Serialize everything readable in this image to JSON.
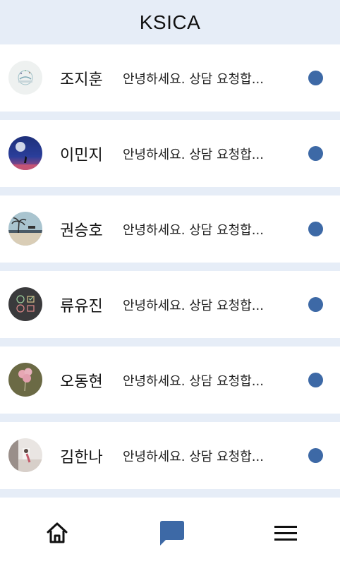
{
  "app": {
    "title": "KSICA"
  },
  "conversations": [
    {
      "name": "조지훈",
      "preview": "안녕하세요. 상담 요청합...",
      "unread": true,
      "avatar": "leaf-art"
    },
    {
      "name": "이민지",
      "preview": "안녕하세요. 상담 요청합...",
      "unread": true,
      "avatar": "night-moon"
    },
    {
      "name": "권승호",
      "preview": "안녕하세요. 상담 요청합...",
      "unread": true,
      "avatar": "beach-palm"
    },
    {
      "name": "류유진",
      "preview": "안녕하세요. 상담 요청합...",
      "unread": true,
      "avatar": "emoji-chalkboard"
    },
    {
      "name": "오동현",
      "preview": "안녕하세요. 상담 요청합...",
      "unread": true,
      "avatar": "pink-balloons"
    },
    {
      "name": "김한나",
      "preview": "안녕하세요. 상담 요청합...",
      "unread": true,
      "avatar": "room-photo"
    }
  ],
  "nav": {
    "items": [
      {
        "icon": "home-icon",
        "active": false
      },
      {
        "icon": "chat-icon",
        "active": true
      },
      {
        "icon": "menu-icon",
        "active": false
      }
    ]
  },
  "colors": {
    "header_bg": "#e6edf7",
    "unread_dot": "#3d69a6",
    "active_nav": "#3d69a6",
    "inactive_nav": "#111111"
  }
}
